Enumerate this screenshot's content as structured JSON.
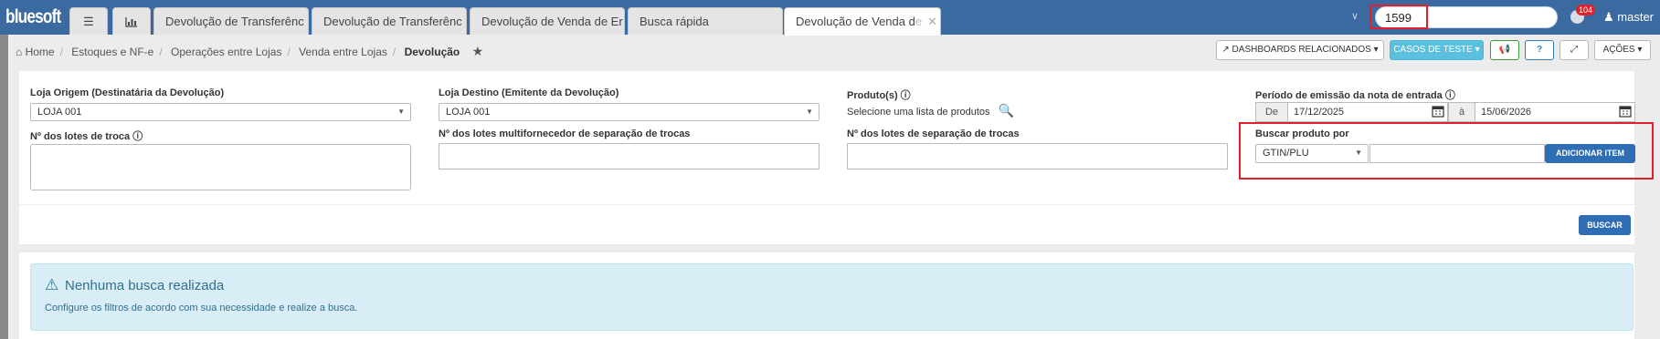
{
  "app": {
    "logo": "bluesoft"
  },
  "tabs": [
    {
      "label": "Devolução de Transferênc"
    },
    {
      "label": "Devolução de Transferênc"
    },
    {
      "label": "Devolução de Venda de Er"
    },
    {
      "label": "Busca rápida"
    },
    {
      "label_main": "Devolução de Venda d",
      "label_fade": "e"
    }
  ],
  "header": {
    "search_value": "1599",
    "notifications_count": "104",
    "user": "master"
  },
  "breadcrumb": {
    "items": [
      "Home",
      "Estoques e NF-e",
      "Operações entre Lojas",
      "Venda entre Lojas"
    ],
    "current": "Devolução"
  },
  "toolbar": {
    "dashboards": "DASHBOARDS RELACIONADOS",
    "casos": "CASOS DE TESTE",
    "acoes": "AÇÕES"
  },
  "form": {
    "loja_origem_label": "Loja Origem (Destinatária da Devolução)",
    "loja_origem_value": "LOJA 001",
    "loja_destino_label": "Loja Destino (Emitente da Devolução)",
    "loja_destino_value": "LOJA 001",
    "produtos_label": "Produto(s)",
    "produtos_text": "Selecione uma lista de produtos",
    "periodo_label": "Período de emissão da nota de entrada",
    "de_label": "De",
    "de_value": "17/12/2025",
    "a_label": "à",
    "a_value": "15/06/2026",
    "lotes_troca_label": "Nº dos lotes de troca",
    "lotes_multi_label": "Nº dos lotes multifornecedor de separação de trocas",
    "lotes_sep_label": "Nº dos lotes de separação de trocas",
    "buscar_produto_label": "Buscar produto por",
    "buscar_produto_value": "GTIN/PLU",
    "adicionar_item": "ADICIONAR ITEM",
    "buscar": "BUSCAR"
  },
  "alert": {
    "title": "Nenhuma busca realizada",
    "description": "Configure os filtros de acordo com sua necessidade e realize a busca."
  },
  "colors": {
    "topbar": "#3a6aa0",
    "primary": "#2f6db5",
    "highlight": "#e0202a",
    "alert_bg": "#d9edf7"
  }
}
